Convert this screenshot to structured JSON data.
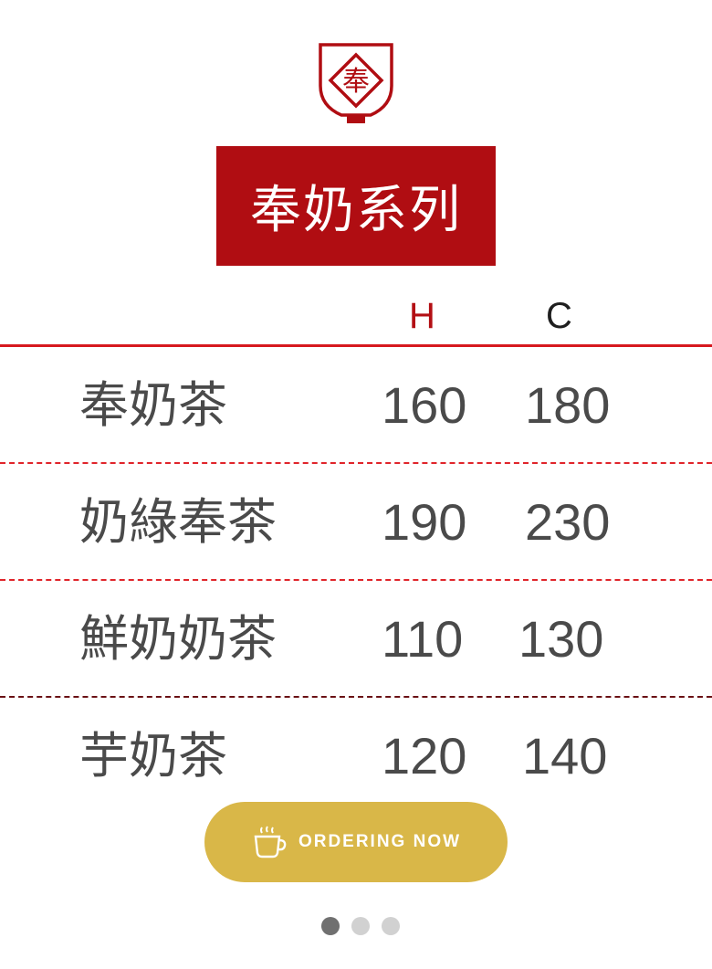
{
  "logo": {
    "char": "奉"
  },
  "title": "奉奶系列",
  "columns": {
    "hot": "H",
    "cold": "C"
  },
  "menu": [
    {
      "name": "奉奶茶",
      "hot": "160",
      "cold": "180"
    },
    {
      "name": "奶綠奉茶",
      "hot": "190",
      "cold": "230"
    },
    {
      "name": "鮮奶奶茶",
      "hot": "110",
      "cold": "130"
    },
    {
      "name": "芋奶茶",
      "hot": "120",
      "cold": "140"
    }
  ],
  "order_button": {
    "label": "ORDERING NOW",
    "icon": "coffee-cup-icon"
  },
  "pagination": {
    "total": 3,
    "active": 1
  },
  "colors": {
    "brand_red": "#b00d12",
    "line_red": "#d7191f",
    "button_gold": "#d9b748",
    "text_gray": "#4a4a4a"
  }
}
